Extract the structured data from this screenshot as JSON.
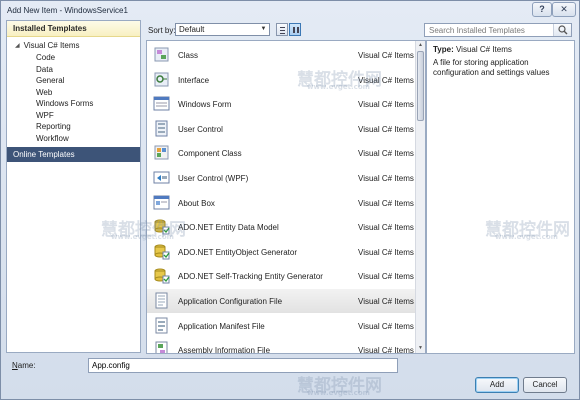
{
  "window": {
    "title": "Add New Item - WindowsService1",
    "help": "?",
    "close": "✕"
  },
  "left": {
    "header": "Installed Templates",
    "root": "Visual C# Items",
    "children": [
      "Code",
      "Data",
      "General",
      "Web",
      "Windows Forms",
      "WPF",
      "Reporting",
      "Workflow"
    ],
    "online": "Online Templates"
  },
  "toolbar": {
    "sort_label": "Sort by:",
    "sort_value": "Default"
  },
  "search": {
    "placeholder": "Search Installed Templates"
  },
  "templates": [
    {
      "name": "Class",
      "lang": "Visual C# Items",
      "icon": "class-icon"
    },
    {
      "name": "Interface",
      "lang": "Visual C# Items",
      "icon": "interface-icon"
    },
    {
      "name": "Windows Form",
      "lang": "Visual C# Items",
      "icon": "windows-form-icon"
    },
    {
      "name": "User Control",
      "lang": "Visual C# Items",
      "icon": "user-control-icon"
    },
    {
      "name": "Component Class",
      "lang": "Visual C# Items",
      "icon": "component-class-icon"
    },
    {
      "name": "User Control (WPF)",
      "lang": "Visual C# Items",
      "icon": "wpf-user-control-icon"
    },
    {
      "name": "About Box",
      "lang": "Visual C# Items",
      "icon": "about-box-icon"
    },
    {
      "name": "ADO.NET Entity Data Model",
      "lang": "Visual C# Items",
      "icon": "entity-data-model-icon"
    },
    {
      "name": "ADO.NET EntityObject Generator",
      "lang": "Visual C# Items",
      "icon": "entityobject-generator-icon"
    },
    {
      "name": "ADO.NET Self-Tracking Entity Generator",
      "lang": "Visual C# Items",
      "icon": "self-tracking-generator-icon"
    },
    {
      "name": "Application Configuration File",
      "lang": "Visual C# Items",
      "icon": "config-file-icon"
    },
    {
      "name": "Application Manifest File",
      "lang": "Visual C# Items",
      "icon": "manifest-file-icon"
    },
    {
      "name": "Assembly Information File",
      "lang": "Visual C# Items",
      "icon": "assembly-info-icon"
    }
  ],
  "selected_index": 10,
  "details": {
    "type_label": "Type:",
    "type_value": "Visual C# Items",
    "description": "A file for storing application configuration and settings values"
  },
  "bottom": {
    "name_label": "Name:",
    "name_value": "App.config",
    "add": "Add",
    "cancel": "Cancel"
  },
  "watermark": {
    "brand": "慧都控件网",
    "url": "www.evget.com"
  },
  "colors": {
    "online_bg": "#3d5478",
    "header_bg": "#f8f0c2",
    "selected_row": "#e6e6e6"
  }
}
